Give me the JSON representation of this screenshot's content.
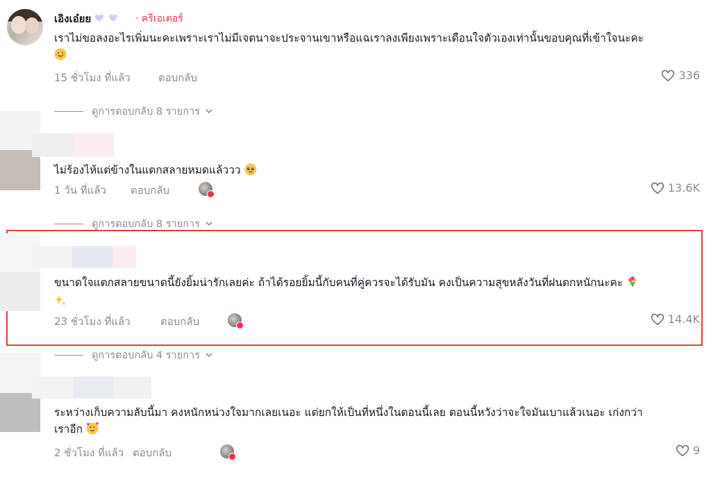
{
  "comments": [
    {
      "username": "เอิงเอ๋ยย",
      "badge": "· ครีเอเตอร์",
      "text": "เราไม่ขอลงอะไรเพิ่มนะคะเพราะเราไม่มีเจตนาจะประจานเขาหรือแฉเราลงเพียงเพราะเดือนใจตัวเองเท่านั้นขอบคุณที่เข้าใจนะคะ",
      "time": "15 ชั่วโมง ที่แล้ว",
      "reply_label": "ตอบกลับ",
      "likes": "336",
      "view_replies": "ดูการตอบกลับ 8 รายการ"
    },
    {
      "text": "ไม่ร้องไห้แต่ข้างในแตกสลายหมดแล้ววว",
      "time": "1 วัน ที่แล้ว",
      "reply_label": "ตอบกลับ",
      "likes": "13.6K",
      "view_replies": "ดูการตอบกลับ 8 รายการ"
    },
    {
      "text": "ขนาดใจแตกสลายขนาดนี้ยังยิ้มน่ารักเลยค่ะ ถ้าได้รอยยิ้มนี้กับคนที่คู่ควรจะได้รับมัน คงเป็นความสุขหลังวันที่ฝนตกหนักนะคะ",
      "time": "23 ชั่วโมง ที่แล้ว",
      "reply_label": "ตอบกลับ",
      "likes": "14.4K",
      "view_replies": "ดูการตอบกลับ 4 รายการ"
    },
    {
      "text": "ระหว่างเก็บความลับนี้มา คงหนักหน่วงใจมากเลยเนอะ แต่ยกให้เป็นที่หนึ่งในตอนนี้เลย ตอนนี้หวังว่าจะใจมันเบาแล้วเนอะ เก่งกว่า",
      "text2": "เราอีก",
      "time": "2 ชั่วโมง ที่แล้ว",
      "reply_label": "ตอบกลับ",
      "likes": "9"
    }
  ],
  "colors": {
    "accent": "#fe2c55",
    "highlight": "#e0413a",
    "muted": "#8a8b91"
  },
  "icons": [
    "heart-icon",
    "chevron-down-icon",
    "creator-avatar-icon"
  ]
}
